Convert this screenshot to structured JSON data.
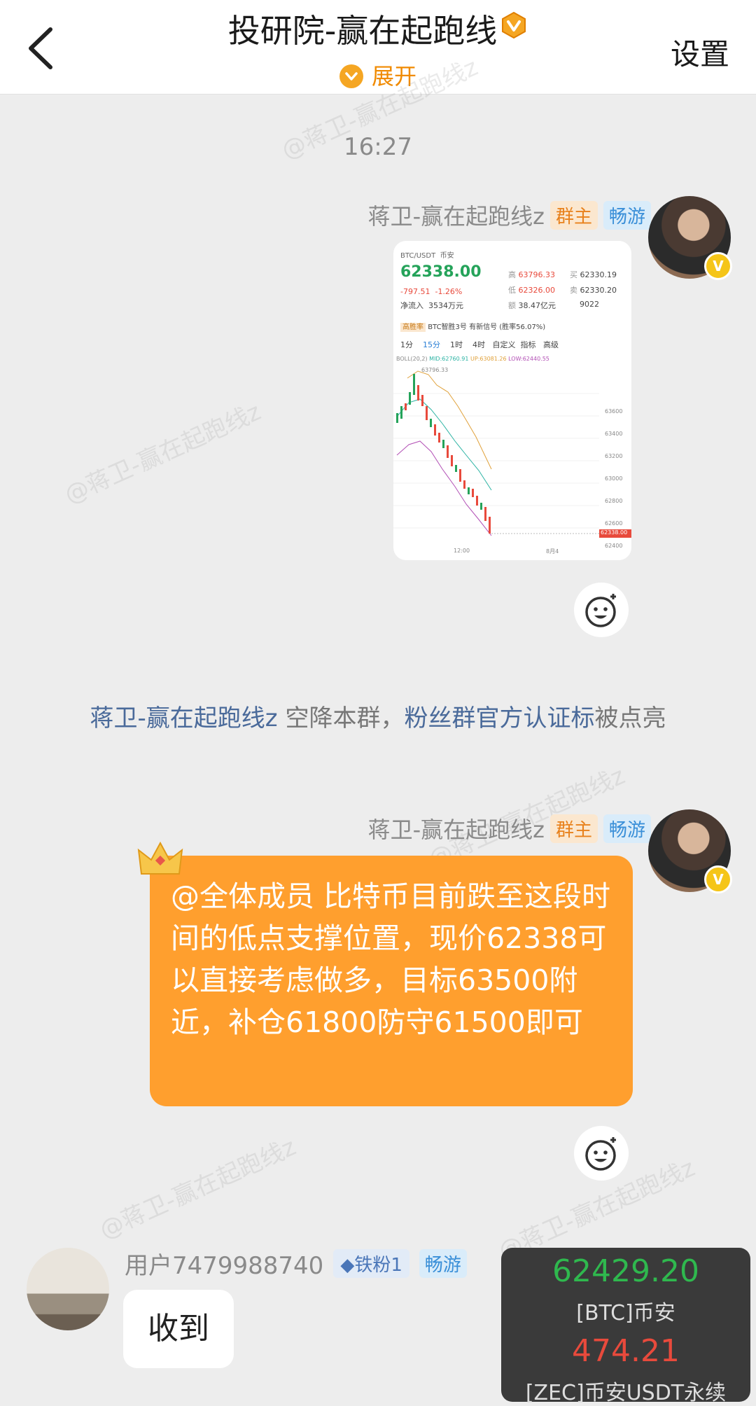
{
  "header": {
    "title": "投研院-赢在起跑线",
    "expand_label": "展开",
    "settings_label": "设置"
  },
  "watermark": "@蒋卫-赢在起跑线z",
  "chat": {
    "timestamp": "16:27",
    "messages": [
      {
        "sender": "蒋卫-赢在起跑线z",
        "role_tag": "群主",
        "tier_tag": "畅游",
        "type": "image",
        "screenshot": {
          "pair": "BTC/USDT",
          "exchange": "币安",
          "price": "62338.00",
          "change": "-797.51",
          "change_pct": "-1.26%",
          "net_inflow_label": "净流入",
          "net_inflow": "3534万元",
          "high_label": "高",
          "high": "63796.33",
          "low_label": "低",
          "low": "62326.00",
          "vol_label": "额",
          "vol": "38.47亿元",
          "buy_label": "买",
          "buy": "62330.19",
          "sell_label": "卖",
          "sell": "62330.20",
          "count": "9022",
          "signal_tag": "高胜率",
          "signal_text": "BTC智胜3号 有新信号 (胜率56.07%)",
          "intervals": [
            "1分",
            "15分",
            "1时",
            "4时",
            "自定义",
            "指标",
            "高级"
          ],
          "boll": "BOLL(20,2)",
          "mid": "MID:62760.91",
          "up": "UP:63081.26",
          "low_band": "LOW:62440.55",
          "peak_label": "63796.33",
          "last_label": "62338.00",
          "y_ticks": [
            "63600",
            "63400",
            "63200",
            "63000",
            "62800",
            "62600",
            "62400"
          ],
          "x_ticks": [
            "12:00",
            "8月4"
          ]
        }
      },
      {
        "sender": "蒋卫-赢在起跑线z",
        "role_tag": "群主",
        "tier_tag": "畅游",
        "type": "text",
        "text": "@全体成员 比特币目前跌至这段时间的低点支撑位置，现价62338可以直接考虑做多，目标63500附近，补仓61800防守61500即可"
      }
    ],
    "system_notice": {
      "name": "蒋卫-赢在起跑线z",
      "middle": " 空降本群，",
      "badge": "粉丝群官方认证标",
      "tail": "被点亮"
    },
    "reply": {
      "sender": "用户7479988740",
      "fan_tag": "铁粉1",
      "tier_tag": "畅游",
      "text": "收到"
    }
  },
  "price_widget": {
    "price1": "62429.20",
    "label1": "[BTC]币安",
    "price2": "474.21",
    "label2": "[ZEC]币安USDT永续"
  },
  "colors": {
    "accent_orange": "#ff9f2e",
    "up_green": "#2fb84e",
    "down_red": "#e84a3c"
  }
}
